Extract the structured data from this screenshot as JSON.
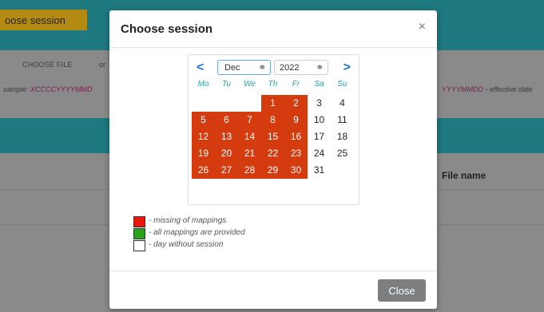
{
  "background": {
    "session_button": "oose session",
    "choose_file": "CHOOSE FILE",
    "or": "or",
    "example_left_prefix": "xample: ",
    "example_left_code": "XCCCCYYYYMMD",
    "example_right_code": "YYYYMMDD",
    "example_right_suffix": " - effective date",
    "file_name_header": "File name"
  },
  "modal": {
    "title": "Choose session",
    "close_x": "×",
    "close_button": "Close"
  },
  "calendar": {
    "prev": "<",
    "next": ">",
    "month": "Dec",
    "year": "2022",
    "select_arrow": "≑",
    "weekdays": [
      "Mo",
      "Tu",
      "We",
      "Th",
      "Fr",
      "Sa",
      "Su"
    ],
    "days": [
      {
        "d": "1",
        "status": "missing"
      },
      {
        "d": "2",
        "status": "missing"
      },
      {
        "d": "3",
        "status": "none"
      },
      {
        "d": "4",
        "status": "none"
      },
      {
        "d": "5",
        "status": "missing"
      },
      {
        "d": "6",
        "status": "missing"
      },
      {
        "d": "7",
        "status": "missing"
      },
      {
        "d": "8",
        "status": "missing"
      },
      {
        "d": "9",
        "status": "missing"
      },
      {
        "d": "10",
        "status": "none"
      },
      {
        "d": "11",
        "status": "none"
      },
      {
        "d": "12",
        "status": "missing"
      },
      {
        "d": "13",
        "status": "missing"
      },
      {
        "d": "14",
        "status": "missing"
      },
      {
        "d": "15",
        "status": "missing"
      },
      {
        "d": "16",
        "status": "missing"
      },
      {
        "d": "17",
        "status": "none"
      },
      {
        "d": "18",
        "status": "none"
      },
      {
        "d": "19",
        "status": "missing"
      },
      {
        "d": "20",
        "status": "missing"
      },
      {
        "d": "21",
        "status": "missing"
      },
      {
        "d": "22",
        "status": "missing"
      },
      {
        "d": "23",
        "status": "missing"
      },
      {
        "d": "24",
        "status": "none"
      },
      {
        "d": "25",
        "status": "none"
      },
      {
        "d": "26",
        "status": "missing"
      },
      {
        "d": "27",
        "status": "missing"
      },
      {
        "d": "28",
        "status": "missing"
      },
      {
        "d": "29",
        "status": "missing"
      },
      {
        "d": "30",
        "status": "missing"
      },
      {
        "d": "31",
        "status": "none"
      }
    ]
  },
  "legend": [
    {
      "color": "#e8170c",
      "text": "- missing of mappings"
    },
    {
      "color": "#2aa21e",
      "text": "- all mappings are provided"
    },
    {
      "color": "#ffffff",
      "text": "- day without session"
    }
  ]
}
